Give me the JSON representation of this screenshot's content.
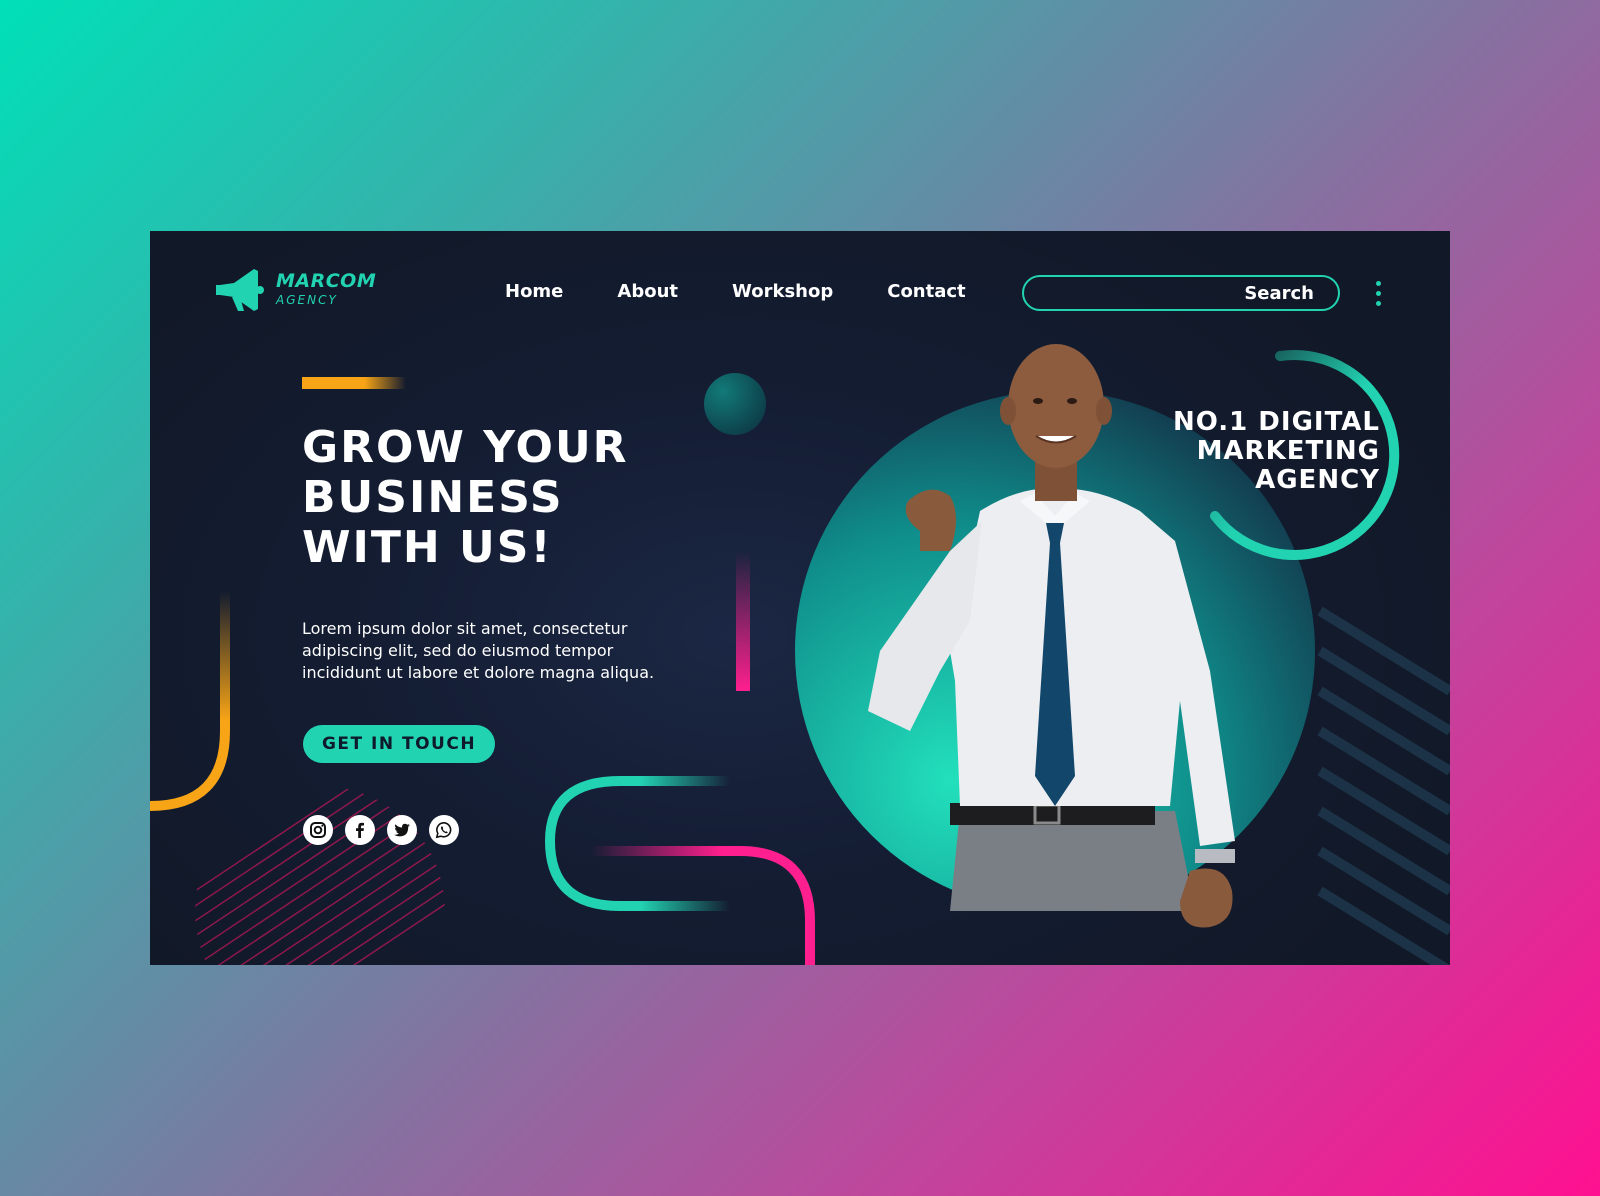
{
  "brand": {
    "name": "MARCOM",
    "sub": "AGENCY",
    "accent": "#22d3b2"
  },
  "nav": {
    "items": [
      "Home",
      "About",
      "Workshop",
      "Contact"
    ]
  },
  "search": {
    "label": "Search"
  },
  "hero": {
    "headline": [
      "GROW YOUR",
      "BUSINESS",
      "WITH US!"
    ],
    "body": "Lorem ipsum dolor sit amet, consectetur adipiscing elit, sed do eiusmod tempor incididunt ut labore et dolore magna aliqua.",
    "cta": "GET IN TOUCH"
  },
  "social": [
    "instagram-icon",
    "facebook-icon",
    "twitter-icon",
    "whatsapp-icon"
  ],
  "tagline": [
    "NO.1 DIGITAL",
    "MARKETING",
    "AGENCY"
  ],
  "colors": {
    "teal": "#22d3b2",
    "orange": "#f7a416",
    "pink": "#ff1f8e",
    "card": "#141d33"
  }
}
